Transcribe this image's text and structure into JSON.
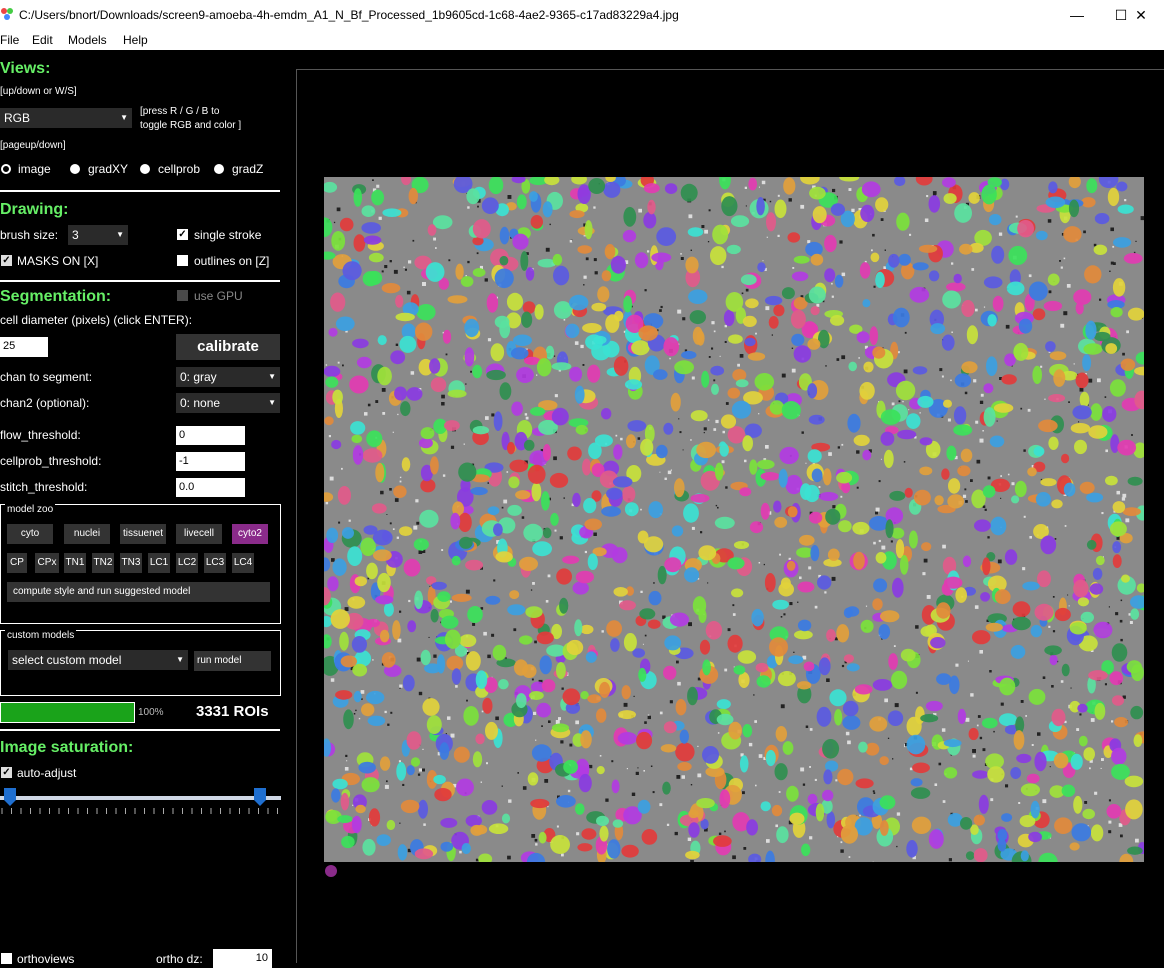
{
  "window": {
    "title": "C:/Users/bnort/Downloads/screen9-amoeba-4h-emdm_A1_N_Bf_Processed_1b9605cd-1c68-4ae2-9365-c17ad83229a4.jpg",
    "minimize": "—",
    "maximize": "☐",
    "close": "✕"
  },
  "menu": [
    "File",
    "Edit",
    "Models",
    "Help"
  ],
  "views": {
    "title": "Views:",
    "hint1": "[up/down or W/S]",
    "select_value": "RGB",
    "hint2": "[press R / G / B to",
    "hint3": " toggle RGB and color ]",
    "hint4": "[pageup/down]",
    "radios": [
      "image",
      "gradXY",
      "cellprob",
      "gradZ"
    ],
    "selected_radio": "image"
  },
  "drawing": {
    "title": "Drawing:",
    "brush_label": "brush size:",
    "brush_value": "3",
    "single_stroke": "single stroke",
    "single_stroke_checked": true,
    "masks_on": "MASKS ON [X]",
    "masks_on_checked": true,
    "outlines_on": "outlines on [Z]",
    "outlines_on_checked": false
  },
  "segmentation": {
    "title": "Segmentation:",
    "use_gpu": "use GPU",
    "diameter_label": "cell diameter (pixels) (click ENTER):",
    "diameter_value": "25",
    "calibrate": "calibrate",
    "chan_label": "chan to segment:",
    "chan_value": "0: gray",
    "chan2_label": "chan2 (optional):",
    "chan2_value": "0: none",
    "flow_label": "flow_threshold:",
    "flow_value": "0",
    "cellprob_label": "cellprob_threshold:",
    "cellprob_value": "-1",
    "stitch_label": "stitch_threshold:",
    "stitch_value": "0.0"
  },
  "model_zoo": {
    "title": "model zoo",
    "row1": [
      "cyto",
      "nuclei",
      "tissuenet",
      "livecell",
      "cyto2"
    ],
    "row2": [
      "CP",
      "CPx",
      "TN1",
      "TN2",
      "TN3",
      "LC1",
      "LC2",
      "LC3",
      "LC4"
    ],
    "selected": "cyto2",
    "compute": "compute style and run suggested model",
    "accent": "#8a2b8a"
  },
  "custom_models": {
    "title": "custom models",
    "select_value": "select custom model",
    "run": "run model"
  },
  "status": {
    "progress": 1.0,
    "progress_text": "100%",
    "rois": "3331 ROIs",
    "bar_color": "#1aa31a"
  },
  "saturation": {
    "title": "Image saturation:",
    "auto_adjust": "auto-adjust",
    "auto_adjust_checked": true,
    "slider_low": 0.0,
    "slider_high": 1.0
  },
  "bottom": {
    "orthoviews": "orthoviews",
    "ortho_dz_label": "ortho dz:",
    "ortho_dz_value": "10"
  }
}
